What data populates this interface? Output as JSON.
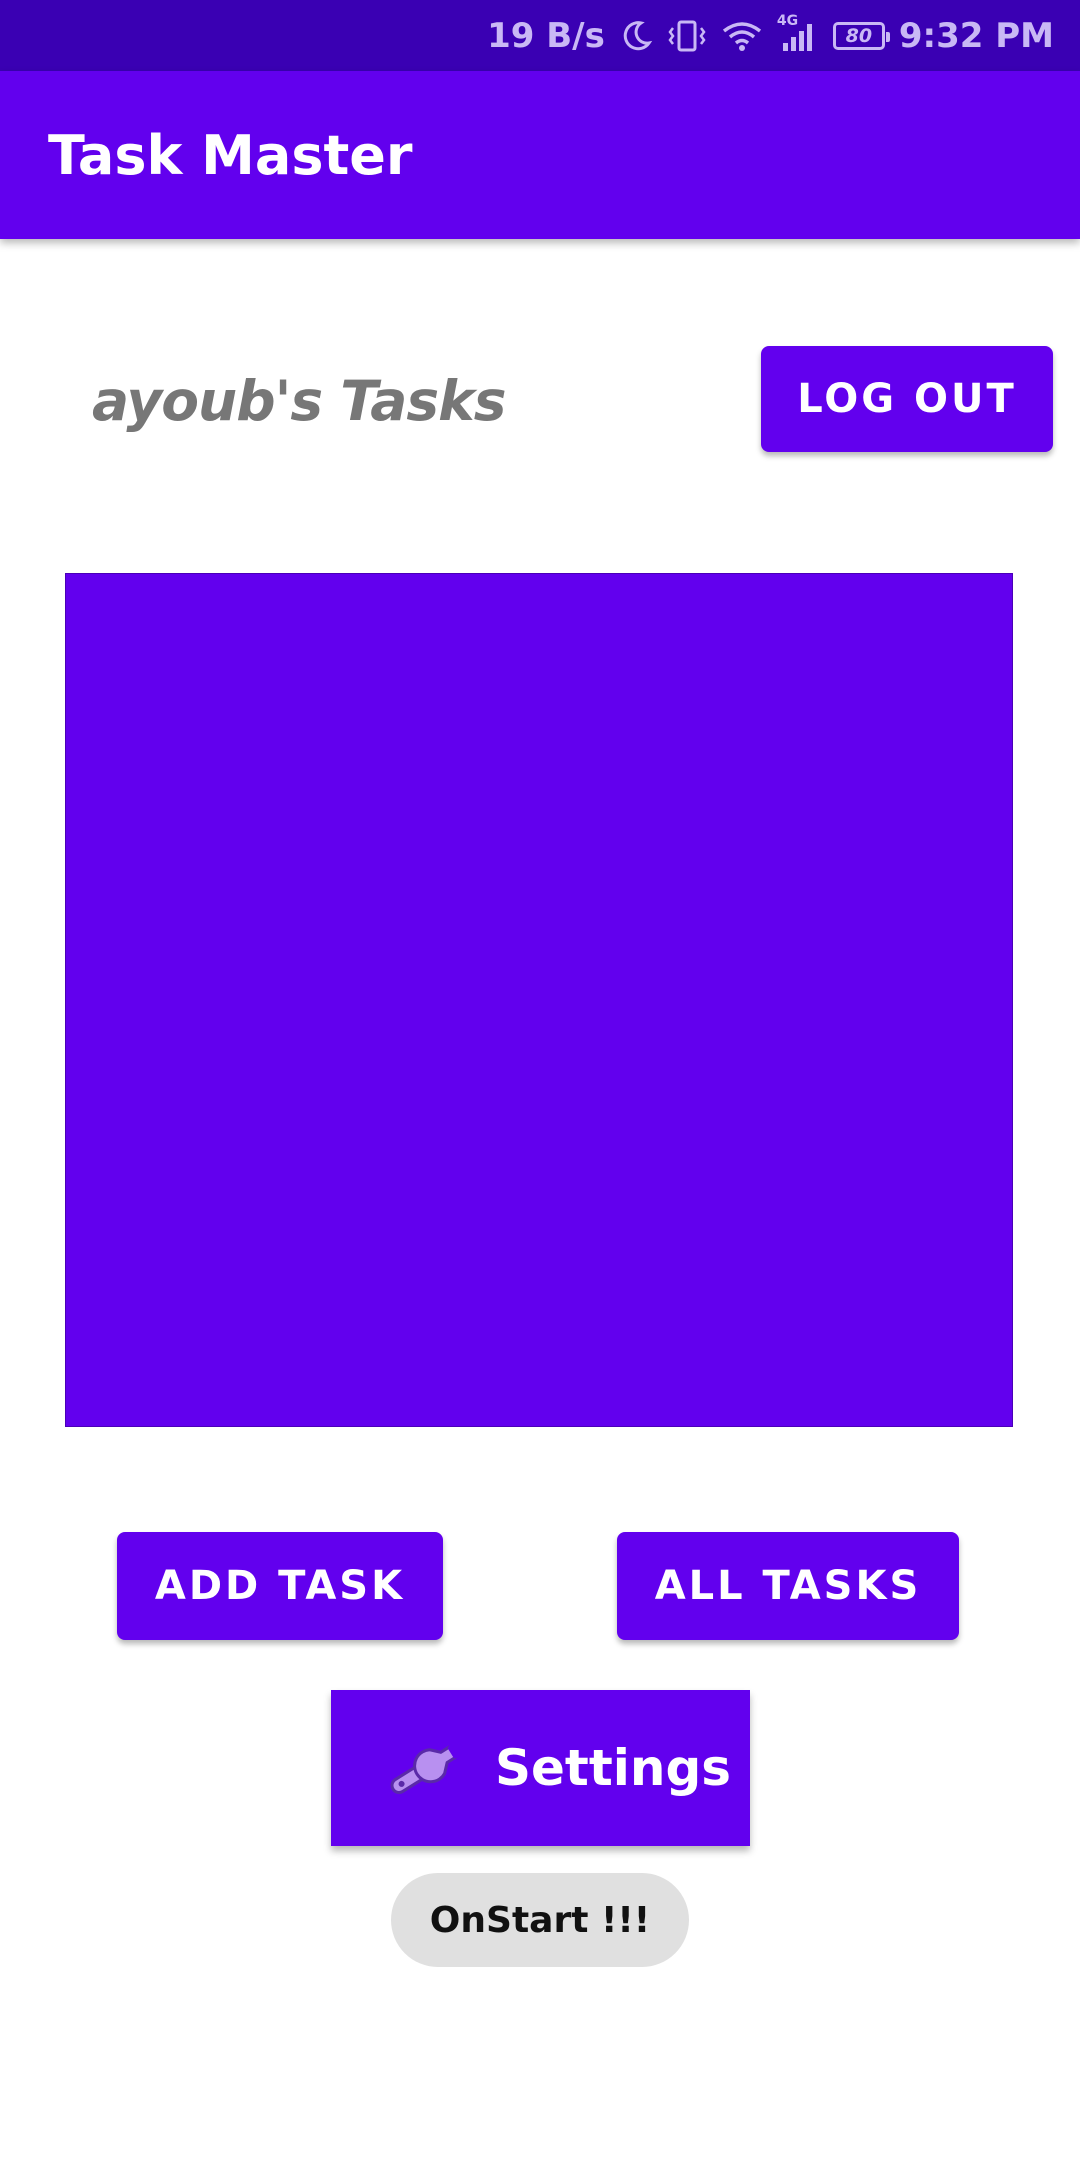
{
  "status_bar": {
    "speed": "19 B/s",
    "network": "4G",
    "battery": "80",
    "time": "9:32 PM",
    "icons": [
      "moon-icon",
      "vibrate-icon",
      "wifi-icon",
      "signal-icon",
      "battery-icon"
    ]
  },
  "app_bar": {
    "title": "Task Master"
  },
  "main": {
    "user_tasks_title": "ayoub's Tasks",
    "logout_label": "LOG OUT",
    "add_task_label": "ADD TASK",
    "all_tasks_label": "ALL TASKS",
    "settings_label": "Settings",
    "settings_icon": "wrench-icon"
  },
  "toast": {
    "message": "OnStart !!!"
  },
  "colors": {
    "primary": "#6200ee",
    "status_bar": "#3a00b3",
    "user_title": "#777777",
    "toast_bg": "#e0e0e0"
  }
}
